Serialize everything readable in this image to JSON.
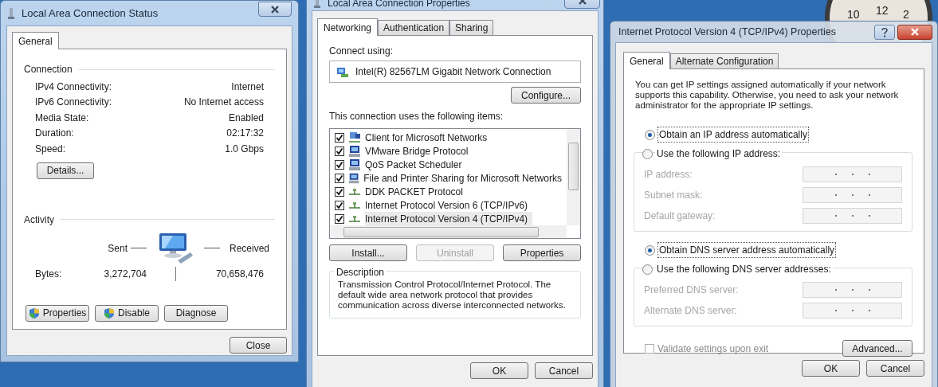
{
  "desktop_clock": {
    "numerals": [
      "10",
      "12",
      "2"
    ]
  },
  "status_window": {
    "title": "Local Area Connection Status",
    "tabs": [
      {
        "label": "General",
        "selected": true
      }
    ],
    "connection": {
      "heading": "Connection",
      "rows": [
        {
          "label": "IPv4 Connectivity:",
          "value": "Internet"
        },
        {
          "label": "IPv6 Connectivity:",
          "value": "No Internet access"
        },
        {
          "label": "Media State:",
          "value": "Enabled"
        },
        {
          "label": "Duration:",
          "value": "02:17:32"
        },
        {
          "label": "Speed:",
          "value": "1.0 Gbps"
        }
      ]
    },
    "details_button": "Details...",
    "activity": {
      "heading": "Activity",
      "sent_label": "Sent",
      "received_label": "Received",
      "bytes_label": "Bytes:",
      "sent": "3,272,704",
      "received": "70,658,476"
    },
    "buttons": [
      {
        "label": "Properties",
        "shield": true
      },
      {
        "label": "Disable",
        "shield": true
      },
      {
        "label": "Diagnose",
        "shield": false
      }
    ],
    "close_button": "Close"
  },
  "properties_window": {
    "title": "Local Area Connection Properties",
    "tabs": [
      {
        "label": "Networking",
        "selected": true
      },
      {
        "label": "Authentication",
        "selected": false
      },
      {
        "label": "Sharing",
        "selected": false
      }
    ],
    "connect_using_label": "Connect using:",
    "adapter": "Intel(R) 82567LM Gigabit Network Connection",
    "configure_button": "Configure...",
    "items_label": "This connection uses the following items:",
    "items": [
      {
        "label": "Client for Microsoft Networks",
        "checked": true,
        "selected": false,
        "kind": "client"
      },
      {
        "label": "VMware Bridge Protocol",
        "checked": true,
        "selected": false,
        "kind": "service"
      },
      {
        "label": "QoS Packet Scheduler",
        "checked": true,
        "selected": false,
        "kind": "service"
      },
      {
        "label": "File and Printer Sharing for Microsoft Networks",
        "checked": true,
        "selected": false,
        "kind": "service"
      },
      {
        "label": "DDK PACKET Protocol",
        "checked": true,
        "selected": false,
        "kind": "protocol"
      },
      {
        "label": "Internet Protocol Version 6 (TCP/IPv6)",
        "checked": true,
        "selected": false,
        "kind": "protocol"
      },
      {
        "label": "Internet Protocol Version 4 (TCP/IPv4)",
        "checked": true,
        "selected": true,
        "kind": "protocol"
      }
    ],
    "buttons": [
      {
        "label": "Install...",
        "disabled": false
      },
      {
        "label": "Uninstall",
        "disabled": true
      },
      {
        "label": "Properties",
        "disabled": false
      }
    ],
    "description_heading": "Description",
    "description": "Transmission Control Protocol/Internet Protocol. The default wide area network protocol that provides communication across diverse interconnected networks.",
    "ok_button": "OK",
    "cancel_button": "Cancel"
  },
  "ipv4_window": {
    "title": "Internet Protocol Version 4 (TCP/IPv4) Properties",
    "tabs": [
      {
        "label": "General",
        "selected": true
      },
      {
        "label": "Alternate Configuration",
        "selected": false
      }
    ],
    "intro": "You can get IP settings assigned automatically if your network supports this capability. Otherwise, you need to ask your network administrator for the appropriate IP settings.",
    "ip_options": [
      {
        "label": "Obtain an IP address automatically",
        "selected": true
      },
      {
        "label": "Use the following IP address:",
        "selected": false
      }
    ],
    "ip_fields": [
      {
        "label": "IP address:",
        "disabled": true
      },
      {
        "label": "Subnet mask:",
        "disabled": true
      },
      {
        "label": "Default gateway:",
        "disabled": true
      }
    ],
    "dns_options": [
      {
        "label": "Obtain DNS server address automatically",
        "selected": true
      },
      {
        "label": "Use the following DNS server addresses:",
        "selected": false
      }
    ],
    "dns_fields": [
      {
        "label": "Preferred DNS server:",
        "disabled": true
      },
      {
        "label": "Alternate DNS server:",
        "disabled": true
      }
    ],
    "validate": {
      "label": "Validate settings upon exit",
      "checked": false,
      "disabled": true
    },
    "advanced_button": "Advanced...",
    "ok_button": "OK",
    "cancel_button": "Cancel"
  }
}
